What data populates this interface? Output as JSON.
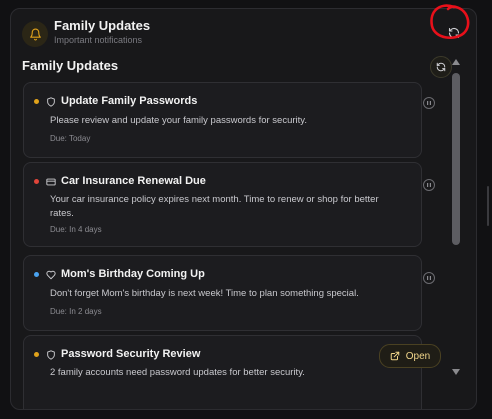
{
  "header": {
    "title": "Family Updates",
    "subtitle": "Important notifications"
  },
  "section": {
    "title": "Family Updates"
  },
  "colors": {
    "accent": "#e0a21b",
    "priority_high": "#e0a21b",
    "priority_urgent": "#e0453a",
    "priority_info": "#4aa3f0",
    "annotation": "#e8101a"
  },
  "notifications": [
    {
      "title": "Update Family Passwords",
      "icon": "shield-icon",
      "priority_color": "#e0a21b",
      "description": "Please review and update your family passwords for security.",
      "due": "Due: Today"
    },
    {
      "title": "Car Insurance Renewal Due",
      "icon": "credit-card-icon",
      "priority_color": "#e0453a",
      "description": "Your car insurance policy expires next month. Time to renew or shop for better rates.",
      "due": "Due: In 4 days"
    },
    {
      "title": "Mom's Birthday Coming Up",
      "icon": "heart-icon",
      "priority_color": "#4aa3f0",
      "description": "Don't forget Mom's birthday is next week! Time to plan something special.",
      "due": "Due: In 2 days"
    },
    {
      "title": "Password Security Review",
      "icon": "shield-icon",
      "priority_color": "#e0a21b",
      "description": "2 family accounts need password updates for better security.",
      "action_label": "Open"
    }
  ]
}
